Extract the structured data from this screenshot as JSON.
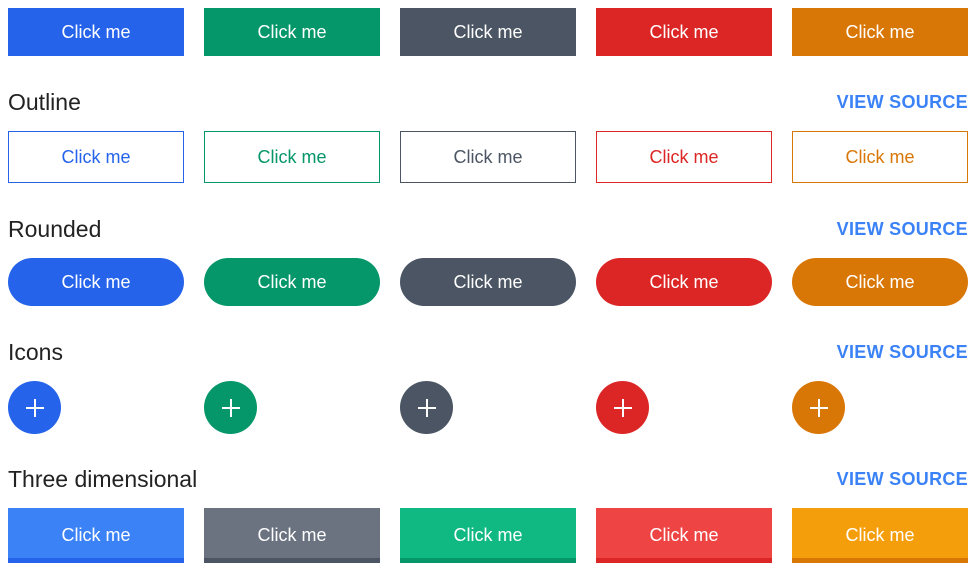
{
  "button_label": "Click me",
  "view_source_label": "VIEW SOURCE",
  "colors": {
    "solid": [
      "#2563eb",
      "#059669",
      "#4b5563",
      "#dc2626",
      "#d97706"
    ],
    "three_dimensional": [
      "#3b82f6",
      "#6b7280",
      "#10b981",
      "#ef4444",
      "#f59e0b"
    ],
    "three_dimensional_border": [
      "#2563eb",
      "#4b5563",
      "#059669",
      "#dc2626",
      "#d97706"
    ]
  },
  "sections": {
    "outline": {
      "title": "Outline"
    },
    "rounded": {
      "title": "Rounded"
    },
    "icons": {
      "title": "Icons",
      "icon": "plus-icon"
    },
    "three_dimensional": {
      "title": "Three dimensional"
    }
  }
}
